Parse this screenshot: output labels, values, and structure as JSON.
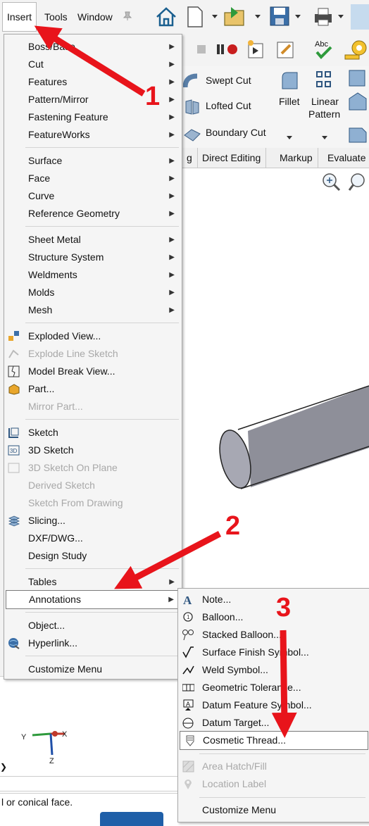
{
  "menubar": {
    "items": [
      "Insert",
      "Tools",
      "Window"
    ],
    "pin_icon": "pin-icon"
  },
  "ribbon": {
    "swept_cut": "Swept Cut",
    "lofted_cut": "Lofted Cut",
    "boundary_cut": "Boundary Cut",
    "fillet": "Fillet",
    "linear_pattern_1": "Linear",
    "linear_pattern_2": "Pattern"
  },
  "tabs": [
    "g",
    "Direct Editing",
    "Markup",
    "Evaluate"
  ],
  "insert_menu": {
    "group1": [
      "Boss/Base",
      "Cut",
      "Features",
      "Pattern/Mirror",
      "Fastening Feature",
      "FeatureWorks"
    ],
    "group2": [
      "Surface",
      "Face",
      "Curve",
      "Reference Geometry"
    ],
    "group3": [
      "Sheet Metal",
      "Structure System",
      "Weldments",
      "Molds",
      "Mesh"
    ],
    "group4": [
      "Exploded View...",
      "Explode Line Sketch",
      "Model Break View...",
      "Part...",
      "Mirror Part..."
    ],
    "group5": [
      "Sketch",
      "3D Sketch",
      "3D Sketch On Plane",
      "Derived Sketch",
      "Sketch From Drawing",
      "Slicing...",
      "DXF/DWG...",
      "Design Study"
    ],
    "group6": [
      "Tables",
      "Annotations"
    ],
    "group7": [
      "Object...",
      "Hyperlink..."
    ],
    "group8": [
      "Customize Menu"
    ]
  },
  "annotations_menu": {
    "items": [
      "Note...",
      "Balloon...",
      "Stacked Balloon...",
      "Surface Finish Symbol...",
      "Weld Symbol...",
      "Geometric Tolerance...",
      "Datum Feature Symbol...",
      "Datum Target...",
      "Cosmetic Thread..."
    ],
    "disabled": [
      "Area Hatch/Fill",
      "Location Label"
    ],
    "customize": "Customize Menu"
  },
  "callouts": [
    "1",
    "2",
    "3"
  ],
  "status_text": "l or conical face.",
  "triad": {
    "x": "X",
    "y": "Y",
    "z": "Z"
  },
  "colors": {
    "arrow_red": "#e8141b",
    "cylinder": "#8e8f99",
    "menu_bg": "#f5f5f5"
  }
}
